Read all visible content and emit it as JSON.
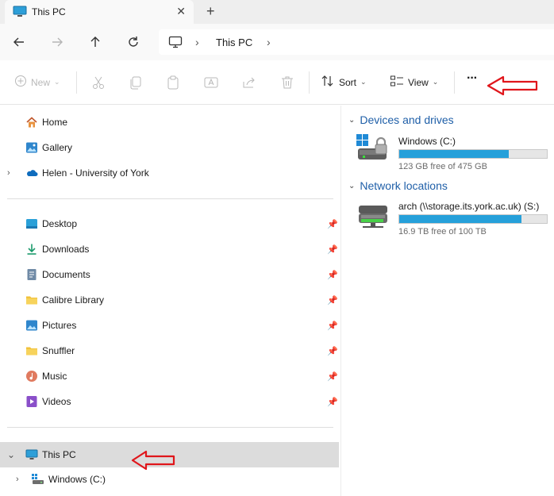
{
  "window": {
    "tab_title": "This PC",
    "close_glyph": "✕",
    "new_tab_glyph": "+"
  },
  "address": {
    "path": "This PC"
  },
  "toolbar": {
    "new_label": "New",
    "sort_label": "Sort",
    "view_label": "View",
    "more_glyph": "···"
  },
  "sidebar": {
    "quick": [
      {
        "label": "Home",
        "icon": "home-icon"
      },
      {
        "label": "Gallery",
        "icon": "gallery-icon"
      },
      {
        "label": "Helen - University of York",
        "icon": "onedrive-icon"
      }
    ],
    "pinned": [
      {
        "label": "Desktop",
        "icon": "desktop-icon"
      },
      {
        "label": "Downloads",
        "icon": "downloads-icon"
      },
      {
        "label": "Documents",
        "icon": "documents-icon"
      },
      {
        "label": "Calibre Library",
        "icon": "folder-icon"
      },
      {
        "label": "Pictures",
        "icon": "pictures-icon"
      },
      {
        "label": "Snuffler",
        "icon": "folder-icon"
      },
      {
        "label": "Music",
        "icon": "music-icon"
      },
      {
        "label": "Videos",
        "icon": "videos-icon"
      }
    ],
    "tree": [
      {
        "label": "This PC",
        "icon": "this-pc-icon",
        "expanded": true,
        "selected": true
      },
      {
        "label": "Windows  (C:)",
        "icon": "windows-drive-icon",
        "expanded": false
      }
    ]
  },
  "content": {
    "devices_heading": "Devices and drives",
    "network_heading": "Network locations",
    "drives": [
      {
        "name": "Windows  (C:)",
        "free": "123 GB free of 475 GB",
        "used_fraction": 0.74
      },
      {
        "name": "arch (\\\\storage.its.york.ac.uk) (S:)",
        "free": "16.9 TB free of 100 TB",
        "used_fraction": 0.83
      }
    ]
  },
  "colors": {
    "accent": "#1f5fa8",
    "drive_fill": "#26a0da",
    "annotation": "#e0161b"
  }
}
